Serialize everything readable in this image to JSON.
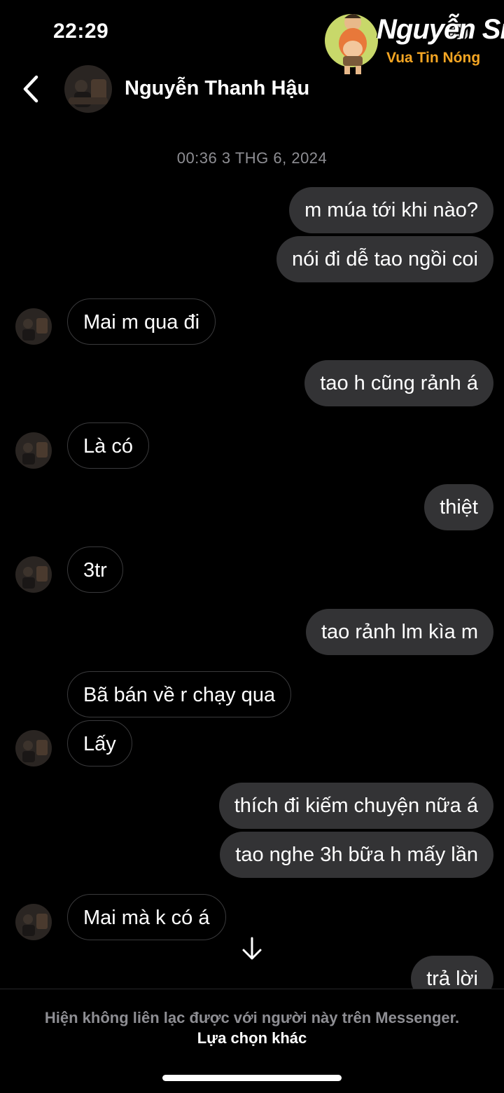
{
  "status_bar": {
    "time": "22:29",
    "battery": "8"
  },
  "header": {
    "contact_name": "Nguyễn Thanh Hậu",
    "back_icon": "chevron-left-icon",
    "avatar_icon": "profile-photo"
  },
  "watermark": {
    "title": "Nguyễn Sin",
    "subtitle": "Vua Tin Nóng"
  },
  "conversation": {
    "timestamp": "00:36 3 THG 6, 2024",
    "messages": [
      {
        "from": "me",
        "text": "m múa tới khi nào?"
      },
      {
        "from": "me",
        "text": "nói đi dễ tao ngồi coi"
      },
      {
        "from": "them",
        "text": "Mai m qua đi"
      },
      {
        "from": "me",
        "text": "tao h cũng rảnh á"
      },
      {
        "from": "them",
        "text": "Là có"
      },
      {
        "from": "me",
        "text": "thiệt"
      },
      {
        "from": "them",
        "text": "3tr"
      },
      {
        "from": "me",
        "text": "tao rảnh lm kìa m"
      },
      {
        "from": "them",
        "text": "Bã bán về r chạy qua"
      },
      {
        "from": "them",
        "text": "Lấy"
      },
      {
        "from": "me",
        "text": "thích đi kiếm chuyện nữa á"
      },
      {
        "from": "me",
        "text": "tao nghe 3h bữa h mấy lần"
      },
      {
        "from": "them",
        "text": "Mai mà k có á"
      },
      {
        "from": "me",
        "text": "trả lời"
      }
    ],
    "scroll_icon": "arrow-down-icon"
  },
  "footer": {
    "notice": "Hiện không liên lạc được với người này trên Messenger.",
    "link": "Lựa chọn khác"
  },
  "colors": {
    "background": "#000000",
    "sent_bubble": "#333335",
    "received_border": "#3a3a3c",
    "muted_text": "#8e8e93",
    "watermark_accent": "#f5a623"
  }
}
